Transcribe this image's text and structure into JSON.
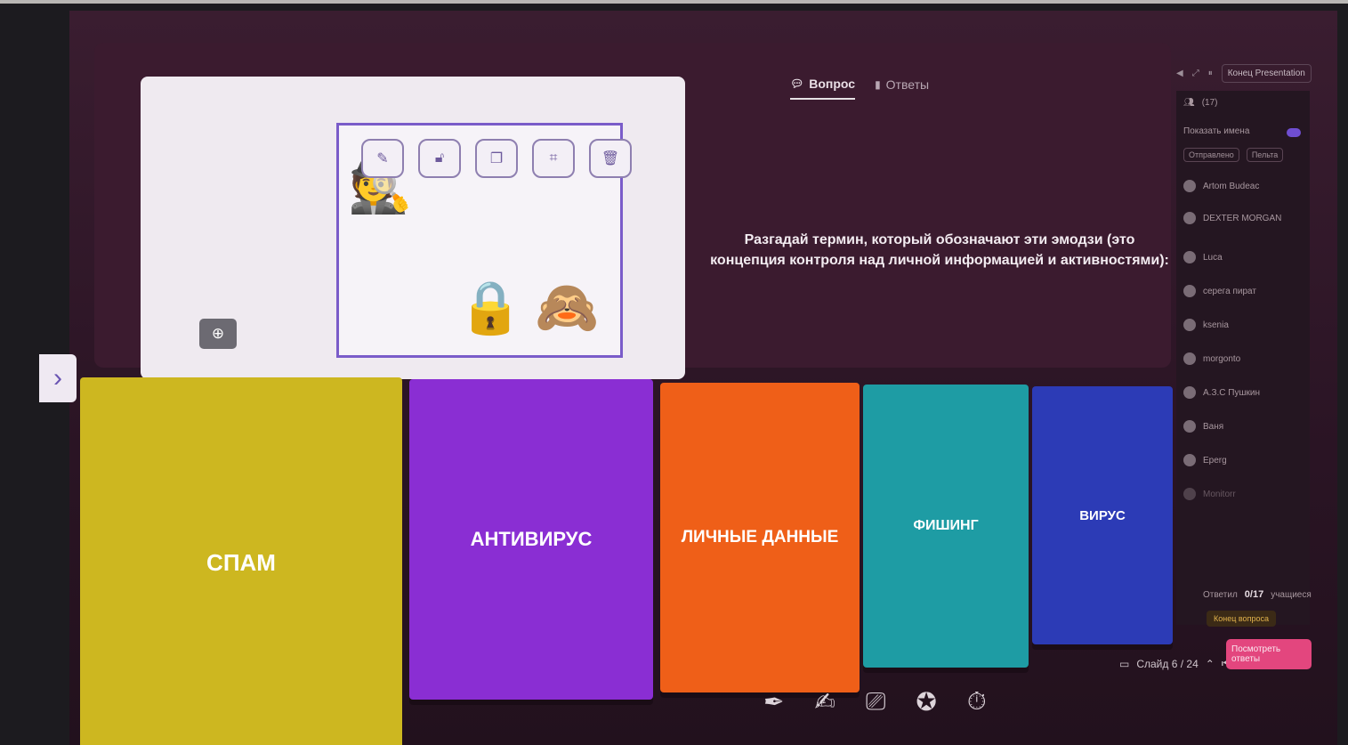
{
  "tabs": [
    {
      "label": "Вопрос",
      "icon": "chat-bubble-icon",
      "active": true
    },
    {
      "label": "Ответы",
      "icon": "bar-chart-icon",
      "active": false
    }
  ],
  "question": {
    "text": "Разгадай термин, который обозначают эти эмодзи (это концепция контроля над личной информацией и активностями):",
    "emojis": [
      "🕵",
      "🔒",
      "🙈"
    ]
  },
  "image_tools": [
    "pencil-icon",
    "unlock-icon",
    "copy-icon",
    "crop-icon",
    "trash-icon"
  ],
  "answers": [
    {
      "label": "СПАМ",
      "color": "#cdb720"
    },
    {
      "label": "АНТИВИРУС",
      "color": "#8a2ed3"
    },
    {
      "label": "ЛИЧНЫЕ ДАННЫЕ",
      "color": "#ef5f18"
    },
    {
      "label": "ФИШИНГ",
      "color": "#1e9ca4"
    },
    {
      "label": "ВИРУС",
      "color": "#2c3bb6"
    }
  ],
  "sidebar": {
    "end_presentation": "Конец Presentation",
    "participants_count": "(17)",
    "show_names": "Показать имена",
    "filter_sent": "Отправлено",
    "filter_pending": "Пельта",
    "participants": [
      "Artom Budeac",
      "DEXTER MORGAN",
      "Luca",
      "серега пират",
      "ksenia",
      "morgonto",
      "А.З.С Пушкин",
      "Ваня",
      "Eperg",
      "Monitorr"
    ],
    "answered_prefix": "Ответил",
    "answered_count": "0/17",
    "answered_suffix": "учащиеся",
    "end_question": "Конец вопроса"
  },
  "footer": {
    "slide_label": "Слайд 6 / 24",
    "show_answers_button": "Посмотреть ответы",
    "tools": [
      "pen-icon",
      "whiteboard-icon",
      "screen-share-icon",
      "spinner-wheel-icon",
      "timer-icon"
    ]
  },
  "colors": {
    "accent": "#7a5cc9",
    "background": "#2a1424",
    "show_answers": "#e3467e"
  }
}
